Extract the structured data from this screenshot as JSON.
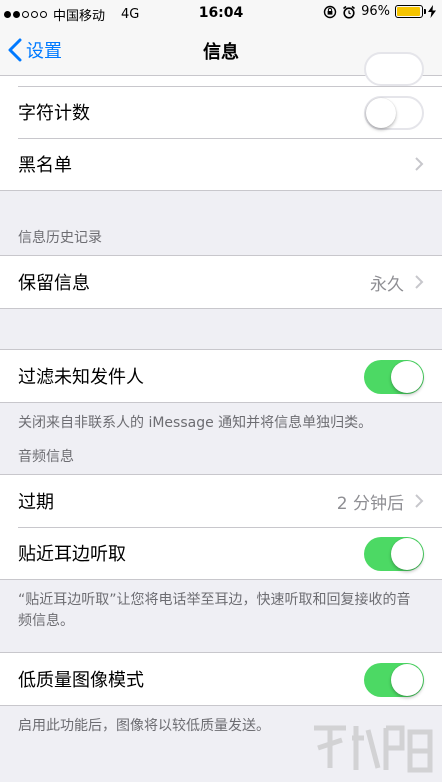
{
  "status": {
    "carrier": "中国移动",
    "network": "4G",
    "time": "16:04",
    "battery": "96%",
    "battery_level": 0.96
  },
  "nav": {
    "back_label": "设置",
    "title": "信息"
  },
  "rows": {
    "char_count": "字符计数",
    "blacklist": "黑名单",
    "keep_messages": "保留信息",
    "keep_messages_value": "永久",
    "filter_unknown": "过滤未知发件人",
    "expire": "过期",
    "expire_value": "2 分钟后",
    "raise_to_listen": "贴近耳边听取",
    "low_quality": "低质量图像模式"
  },
  "sections": {
    "history": "信息历史记录",
    "audio": "音频信息"
  },
  "footers": {
    "filter": "关闭来自非联系人的 iMessage 通知并将信息单独归类。",
    "raise": "“贴近耳边听取”让您将电话举至耳边，快速听取和回复接收的音频信息。",
    "low_quality": "启用此功能后，图像将以较低质量发送。"
  },
  "toggles": {
    "char_count": false,
    "filter_unknown": true,
    "raise_to_listen": true,
    "low_quality": true
  },
  "colors": {
    "accent": "#007aff",
    "toggle_on": "#4cd964",
    "battery": "#f5c400"
  }
}
